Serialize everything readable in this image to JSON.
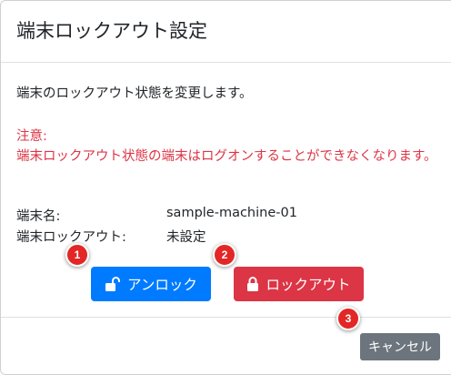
{
  "dialog": {
    "title": "端末ロックアウト設定",
    "description": "端末のロックアウト状態を変更します。",
    "warning_heading": "注意:",
    "warning_text": "端末ロックアウト状態の端末はログオンすることができなくなります。"
  },
  "info": {
    "machine_label": "端末名:",
    "machine_value": "sample-machine-01",
    "lockout_label": "端末ロックアウト:",
    "lockout_value": "未設定"
  },
  "buttons": {
    "unlock_label": "アンロック",
    "unlock_icon": "unlock-icon",
    "lock_label": "ロックアウト",
    "lock_icon": "lock-icon",
    "cancel_label": "キャンセル"
  },
  "annotations": {
    "badge_1": "1",
    "badge_2": "2",
    "badge_3": "3"
  },
  "colors": {
    "primary": "#007bff",
    "danger": "#dc3545",
    "secondary": "#6c757d",
    "badge": "#e32626"
  }
}
